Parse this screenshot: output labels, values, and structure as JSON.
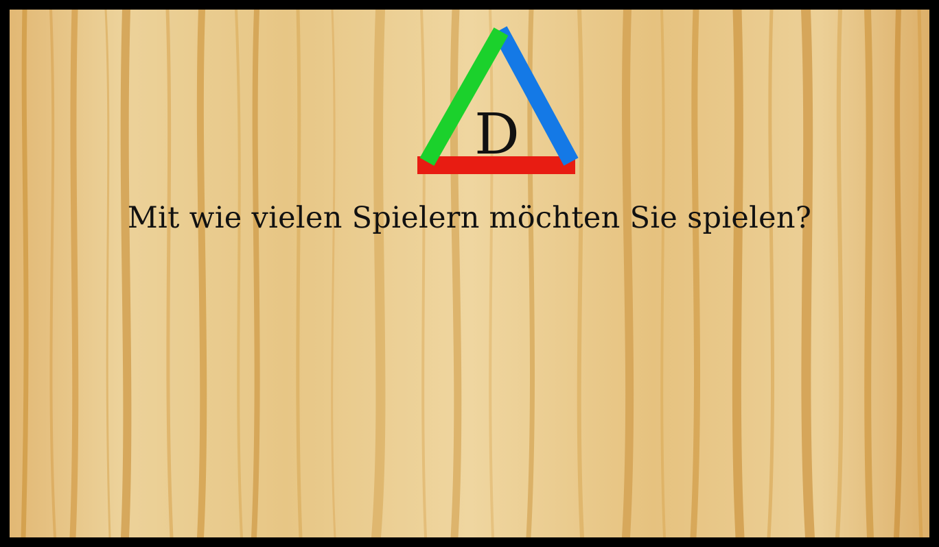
{
  "logo": {
    "letter": "D",
    "colors": {
      "left_bar": "#1bd12c",
      "right_bar": "#1479e6",
      "bottom_bar": "#e81c12"
    }
  },
  "prompt": {
    "text": "Mit wie vielen Spielern möchten Sie spielen?"
  },
  "theme": {
    "background": "wood-texture",
    "frame_color": "#000000",
    "wood_base": "#e9c98a"
  }
}
